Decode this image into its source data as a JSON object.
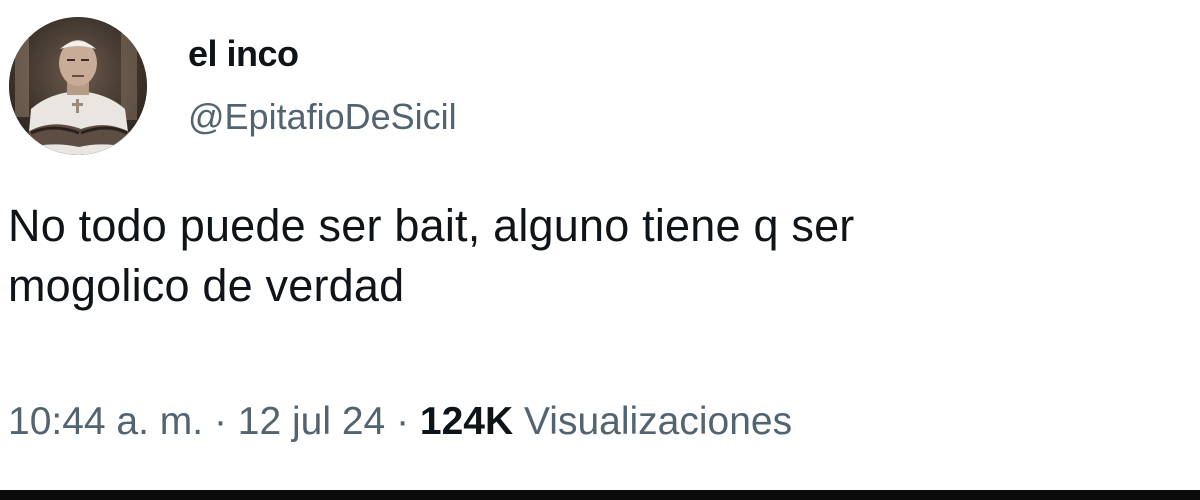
{
  "author": {
    "display_name": "el inco",
    "handle": "@EpitafioDeSicil",
    "avatar_icon": "profile-photo"
  },
  "tweet": {
    "text": "No todo puede ser bait, alguno tiene q ser\nmogolico de verdad",
    "time": "10:44 a. m.",
    "separator_1": " · ",
    "date": "12 jul 24",
    "separator_2": " · ",
    "views_count": "124K",
    "views_label": " Visualizaciones"
  },
  "colors": {
    "text_primary": "#0f1419",
    "text_secondary": "#536471",
    "background": "#ffffff"
  }
}
